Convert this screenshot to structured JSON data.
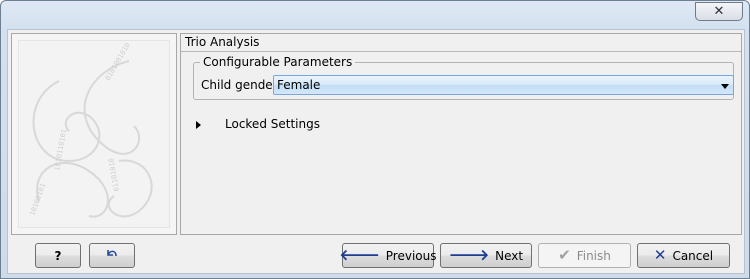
{
  "window": {
    "close_label": "✕"
  },
  "panel": {
    "title": "Trio Analysis"
  },
  "parameters": {
    "group_title": "Configurable Parameters",
    "child_gender_label": "Child gender",
    "child_gender_value": "Female"
  },
  "locked": {
    "label": "Locked Settings"
  },
  "buttons": {
    "help": "?",
    "previous": "Previous",
    "next": "Next",
    "finish": "Finish",
    "cancel": "Cancel"
  },
  "icons": {
    "help": "help-icon",
    "reset": "undo-arrow-icon",
    "previous": "arrow-left-icon",
    "next": "arrow-right-icon",
    "finish": "checkmark-icon",
    "cancel": "x-icon"
  }
}
